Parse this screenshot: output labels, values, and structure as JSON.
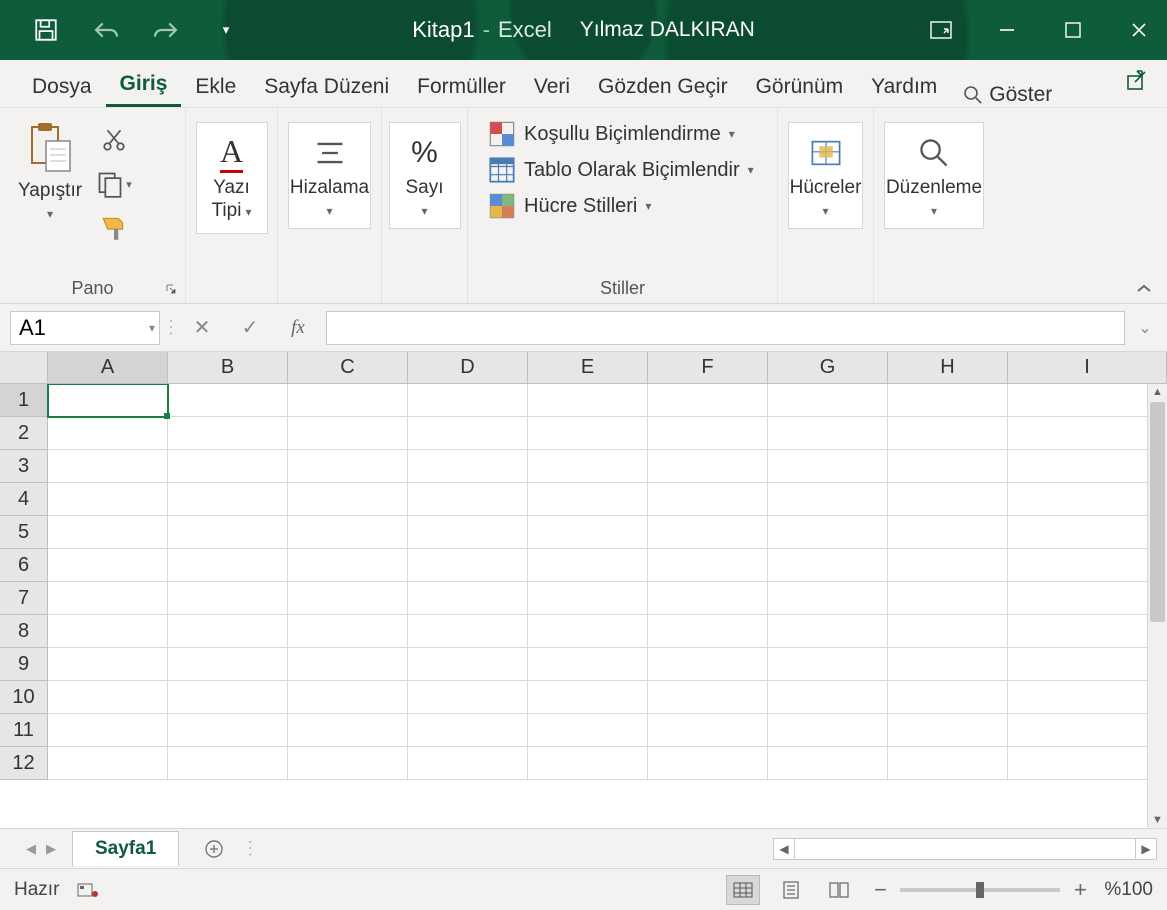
{
  "title": {
    "document": "Kitap1",
    "separator": "-",
    "app": "Excel",
    "user": "Yılmaz DALKIRAN"
  },
  "tabs": [
    "Dosya",
    "Giriş",
    "Ekle",
    "Sayfa Düzeni",
    "Formüller",
    "Veri",
    "Gözden Geçir",
    "Görünüm",
    "Yardım"
  ],
  "active_tab": 1,
  "tell_me": "Göster",
  "ribbon": {
    "pano": {
      "paste": "Yapıştır",
      "group": "Pano"
    },
    "font": {
      "label": "Yazı Tipi"
    },
    "align": {
      "label": "Hizalama"
    },
    "number": {
      "label": "Sayı"
    },
    "styles": {
      "conditional": "Koşullu Biçimlendirme",
      "table": "Tablo Olarak Biçimlendir",
      "cell": "Hücre Stilleri",
      "group": "Stiller"
    },
    "cells": {
      "label": "Hücreler"
    },
    "editing": {
      "label": "Düzenleme"
    }
  },
  "name_box": "A1",
  "fx": "fx",
  "columns": [
    "A",
    "B",
    "C",
    "D",
    "E",
    "F",
    "G",
    "H",
    "I"
  ],
  "rows": [
    1,
    2,
    3,
    4,
    5,
    6,
    7,
    8,
    9,
    10,
    11,
    12
  ],
  "selected_cell": {
    "row": 1,
    "col": "A"
  },
  "sheet": {
    "name": "Sayfa1"
  },
  "status": {
    "ready": "Hazır",
    "zoom": "%100"
  }
}
